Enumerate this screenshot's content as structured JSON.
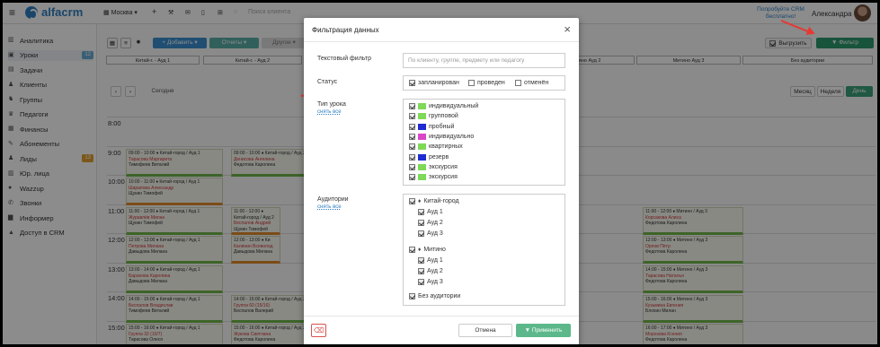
{
  "topbar": {
    "logo_text": "alfacrm",
    "city": "Москва",
    "search_placeholder": "Поиск клиента",
    "promo": "Попробуйте CRM бесплатно!",
    "user_name": "Александра"
  },
  "sidebar": {
    "items": [
      {
        "label": "Аналитика",
        "icon": "chart-icon"
      },
      {
        "label": "Уроки",
        "icon": "calendar-icon",
        "badge": "12",
        "badge_color": "#6aaed6"
      },
      {
        "label": "Задачи",
        "icon": "tasks-icon"
      },
      {
        "label": "Клиенты",
        "icon": "user-icon"
      },
      {
        "label": "Группы",
        "icon": "users-icon"
      },
      {
        "label": "Педагоги",
        "icon": "graduation-icon"
      },
      {
        "label": "Финансы",
        "icon": "money-icon"
      },
      {
        "label": "Абонементы",
        "icon": "ticket-icon"
      },
      {
        "label": "Лиды",
        "icon": "lead-icon",
        "badge": "13",
        "badge_color": "#e0a030"
      },
      {
        "label": "Юр. лица",
        "icon": "building-icon"
      },
      {
        "label": "Wazzup",
        "icon": "chat-icon"
      },
      {
        "label": "Звонки",
        "icon": "phone-icon"
      },
      {
        "label": "Информер",
        "icon": "info-icon"
      },
      {
        "label": "Доступ в CRM",
        "icon": "lock-icon"
      }
    ]
  },
  "calendar": {
    "toolbar": {
      "add_label": "+ Добавить ▾",
      "reports_label": "Отчеты ▾",
      "other_label": "Другое ▾",
      "today_label": "Сегодня",
      "export_label": "Выгрузить",
      "filter_label": "▼ Фильтр",
      "view_month": "Месяц",
      "view_week": "Неделя",
      "view_day": "День"
    },
    "rooms": [
      "Китай-г. - Ауд 1",
      "Китай-г. - Ауд 2",
      "Митино Ауд 2",
      "Митино Ауд 3",
      "Без аудитории"
    ],
    "times": [
      "8:00",
      "9:00",
      "10:00",
      "11:00",
      "12:00",
      "13:00",
      "14:00",
      "15:00"
    ],
    "events": [
      {
        "line1": "09:00 - 10:00 ♦ Китай-город / Ауд 1",
        "line2": "Тарасова Маргарита",
        "line3": "Тимофеев Виталий"
      },
      {
        "line1": "09:00 - 10:00 ♦ Китай-город / Ауд 2",
        "line2": "Денисова Ангелина",
        "line3": "Федотова Каролина"
      },
      {
        "line1": "10:00 - 11:00 ♦ Китай-город / Ауд 1",
        "line2": "Шарапова Александр",
        "line3": "Щукин Тимофей"
      },
      {
        "line1": "11:00 - 12:00 ♦ Китай-город / Ауд 1",
        "line2": "Журавлёв Милан",
        "line3": "Щукин Тимофей"
      },
      {
        "line1": "11:00 - 12:00 ♦ Китай-город / Ауд 2",
        "line2": "Беспалов Андрей",
        "line3": "Щукин Тимофей"
      },
      {
        "line1": "12:00 - 13:00 ♦ Китай-город / Ауд 1",
        "line2": "Петрова Милана",
        "line3": "Давыдова Милана"
      },
      {
        "line1": "12:00 - 13:00 ♦ Ки",
        "line2": "Калинин Всеволод",
        "line3": "Давыдова Милана"
      },
      {
        "line1": "13:00 - 14:00 ♦ Китай-город / Ауд 1",
        "line2": "Баранова Каролина",
        "line3": "Давыдова Милана"
      },
      {
        "line1": "14:00 - 15:00 ♦ Китай-город / Ауд 1",
        "line2": "Беспалов Владислав",
        "line3": "Тимофеев Виталий"
      },
      {
        "line1": "14:00 - 15:00 ♦ Китай-город / Ауд 2",
        "line2": "Группа 60 (15/16)",
        "line3": "Беспалов Валерий"
      },
      {
        "line1": "15:00 - 16:00 ♦ Китай-город / Ауд 1",
        "line2": "Группа 32 (10/7)",
        "line3": "Тарасова Олеся"
      },
      {
        "line1": "15:00 - 16:00 ♦ Китай-город / Ауд 2",
        "line2": "Жукова Светлана",
        "line3": "Федотова Каролина"
      },
      {
        "line1": "11:00 - 12:00 ♦ Митино / Ауд 3",
        "line2": "Корсакова Алиса",
        "line3": "Федотова Каролина"
      },
      {
        "line1": "12:00 - 13:00 ♦ Митино / Ауд 3",
        "line2": "Орлов Пётр",
        "line3": "Федотова Каролина"
      },
      {
        "line1": "14:00 - 15:00 ♦ Митино / Ауд 3",
        "line2": "Тарасова Наталья",
        "line3": "Федотова Каролина"
      },
      {
        "line1": "15:00 - 16:00 ♦ Митино / Ауд 3",
        "line2": "Кузьмина Евгения",
        "line3": "Блохин Милан"
      },
      {
        "line1": "16:00 - 17:00 ♦ Митино / Ауд 3",
        "line2": "Морозова Ксения",
        "line3": "Федотова Каролина"
      }
    ]
  },
  "modal": {
    "title": "Фильтрация данных",
    "text_filter_label": "Текстовый фильтр",
    "text_filter_placeholder": "По клиенту, группе, предмету или педагогу",
    "status_label": "Статус",
    "statuses": [
      {
        "label": "запланирован",
        "checked": true
      },
      {
        "label": "проведен",
        "checked": false
      },
      {
        "label": "отменён",
        "checked": false
      }
    ],
    "lesson_type_label": "Тип урока",
    "lesson_type_clear": "снять все",
    "lesson_types": [
      {
        "label": "индивидуальный",
        "color": "#7ed957",
        "checked": true
      },
      {
        "label": "групповой",
        "color": "#7ed957",
        "checked": true
      },
      {
        "label": "пробный",
        "color": "#1f2bd1",
        "checked": true
      },
      {
        "label": "индивидуально",
        "color": "#d946c8",
        "checked": true
      },
      {
        "label": "квартирных",
        "color": "#7ed957",
        "checked": true
      },
      {
        "label": "резерв",
        "color": "#1f2bd1",
        "checked": true
      },
      {
        "label": "экскурсия",
        "color": "#7ed957",
        "checked": true
      },
      {
        "label": "экскурсия",
        "color": "#7ed957",
        "checked": true
      }
    ],
    "rooms_label": "Аудитории",
    "rooms_clear": "снять все",
    "locations": [
      {
        "label": "Китай-город",
        "rooms": [
          "Ауд 1",
          "Ауд 2",
          "Ауд 3"
        ]
      },
      {
        "label": "Митино",
        "rooms": [
          "Ауд 1",
          "Ауд 2",
          "Ауд 3"
        ]
      }
    ],
    "no_room_label": "Без аудитории",
    "cancel_label": "Отмена",
    "apply_label": "▼ Применить"
  }
}
